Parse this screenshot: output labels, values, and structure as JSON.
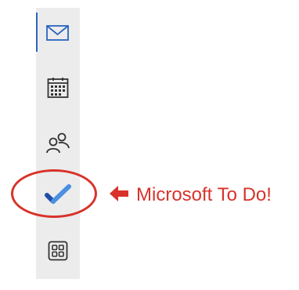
{
  "navigation": {
    "items": [
      {
        "id": "mail",
        "icon": "mail-icon",
        "active": true
      },
      {
        "id": "calendar",
        "icon": "calendar-icon",
        "active": false
      },
      {
        "id": "people",
        "icon": "people-icon",
        "active": false
      },
      {
        "id": "todo",
        "icon": "todo-checkmark-icon",
        "active": false
      },
      {
        "id": "apps",
        "icon": "apps-grid-icon",
        "active": false
      }
    ]
  },
  "annotation": {
    "label": "Microsoft To Do!",
    "arrow_icon": "arrow-left-icon",
    "color": "#d8332b"
  },
  "colors": {
    "rail_background": "#ececec",
    "active_indicator": "#2a64c0",
    "icon_stroke": "#333333",
    "todo_dark_blue": "#1f4fa8",
    "todo_light_blue": "#4a90e2"
  }
}
